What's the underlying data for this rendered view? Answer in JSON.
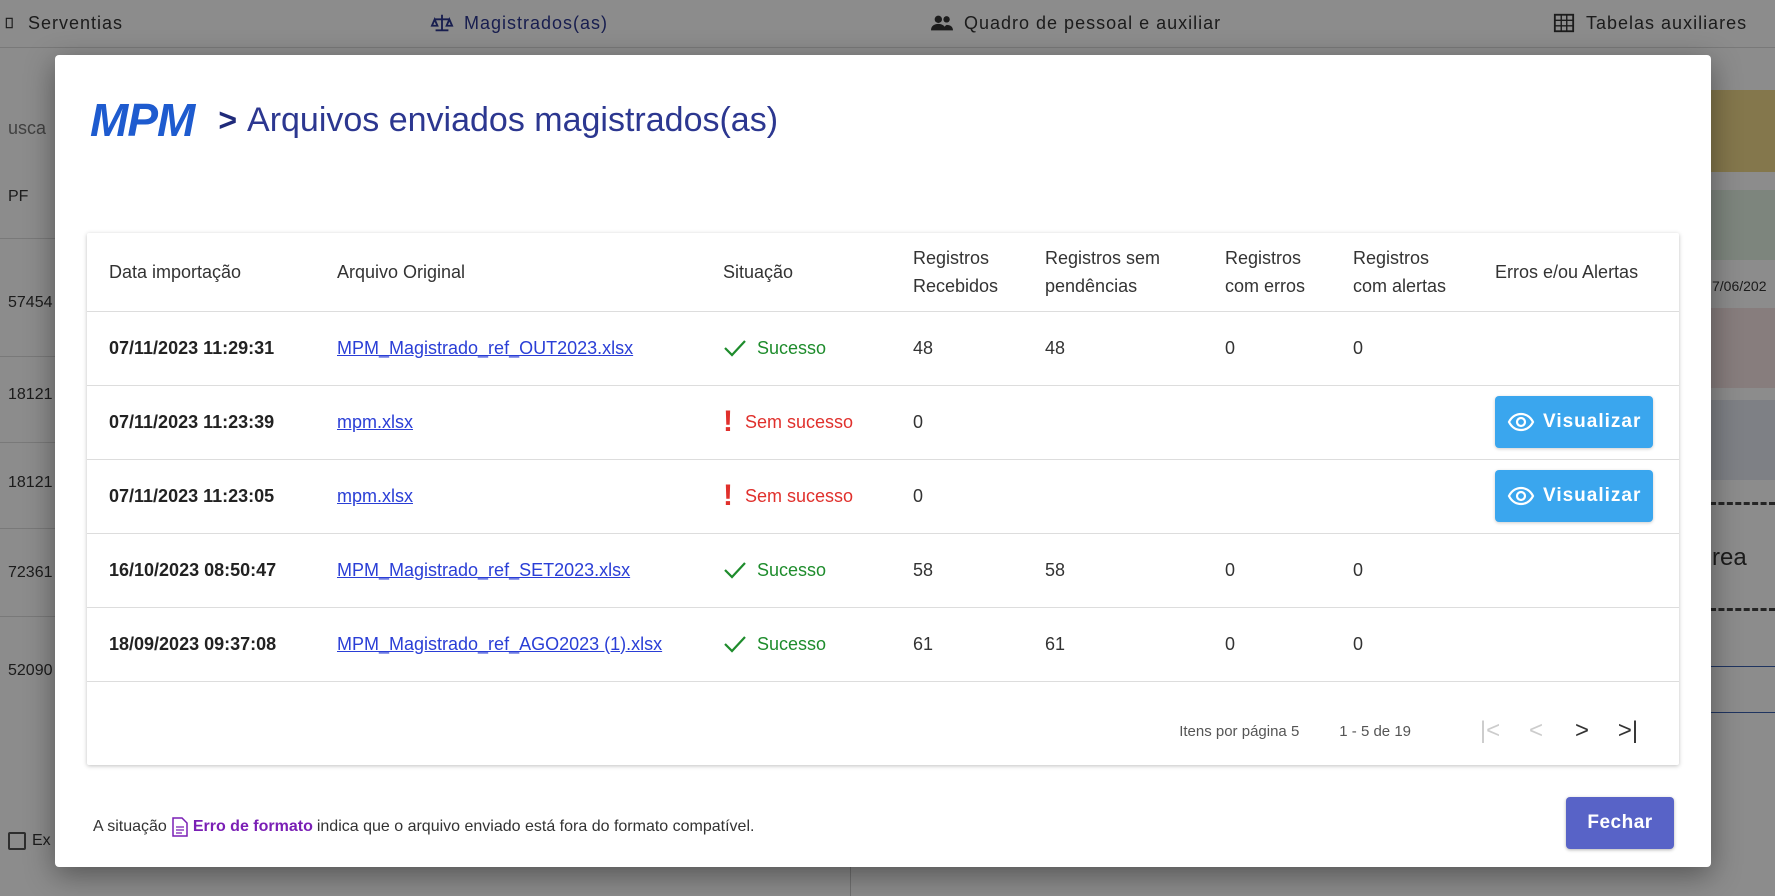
{
  "bg": {
    "nav": {
      "serventias": "Serventias",
      "magistrados": "Magistrados(as)",
      "quadro": "Quadro de pessoal e auxiliar",
      "tabelas": "Tabelas auxiliares"
    },
    "side": {
      "search": "usca",
      "cpf": "PF",
      "rows": [
        "57454",
        "18121",
        "18121",
        "72361",
        "52090"
      ],
      "checkbox_label": "Ex"
    },
    "right": {
      "date": "7/06/202",
      "area": "rea"
    }
  },
  "modal": {
    "logo": "MPM",
    "chevron": ">",
    "title": "Arquivos enviados magistrados(as)",
    "columns": [
      "Data importação",
      "Arquivo Original",
      "Situação",
      "Registros Recebidos",
      "Registros sem pendências",
      "Registros com erros",
      "Registros com alertas",
      "Erros e/ou Alertas"
    ],
    "rows": [
      {
        "date": "07/11/2023 11:29:31",
        "file": "MPM_Magistrado_ref_OUT2023.xlsx",
        "status": "Sucesso",
        "ok": true,
        "received": "48",
        "clean": "48",
        "errors": "0",
        "alerts": "0",
        "action": ""
      },
      {
        "date": "07/11/2023 11:23:39",
        "file": "mpm.xlsx",
        "status": "Sem sucesso",
        "ok": false,
        "received": "0",
        "clean": "",
        "errors": "",
        "alerts": "",
        "action": "Visualizar"
      },
      {
        "date": "07/11/2023 11:23:05",
        "file": "mpm.xlsx",
        "status": "Sem sucesso",
        "ok": false,
        "received": "0",
        "clean": "",
        "errors": "",
        "alerts": "",
        "action": "Visualizar"
      },
      {
        "date": "16/10/2023 08:50:47",
        "file": "MPM_Magistrado_ref_SET2023.xlsx",
        "status": "Sucesso",
        "ok": true,
        "received": "58",
        "clean": "58",
        "errors": "0",
        "alerts": "0",
        "action": ""
      },
      {
        "date": "18/09/2023 09:37:08",
        "file": "MPM_Magistrado_ref_AGO2023 (1).xlsx",
        "status": "Sucesso",
        "ok": true,
        "received": "61",
        "clean": "61",
        "errors": "0",
        "alerts": "0",
        "action": ""
      }
    ],
    "pager": {
      "per_page_label": "Itens por página",
      "per_page_value": "5",
      "range": "1 - 5 de 19",
      "first": "|<",
      "prev": "<",
      "next": ">",
      "last": ">|"
    },
    "footer": {
      "prefix": "A situação",
      "error_label": "Erro de formato",
      "suffix": "indica que o arquivo enviado está fora do formato compatível."
    },
    "close_label": "Fechar"
  },
  "colors": {
    "accent": "#1e5bcf",
    "title": "#2c3790",
    "success": "#1e8c2c",
    "fail": "#e0302c",
    "view_button": "#3aa6ee",
    "close_button": "#5863c7",
    "format_error": "#7a1fb5"
  }
}
